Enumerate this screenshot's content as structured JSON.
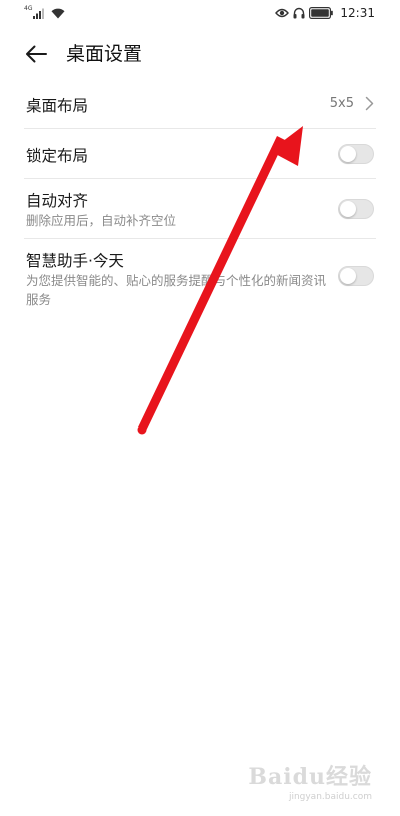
{
  "status_bar": {
    "network_label": "4G",
    "time": "12:31",
    "icons": [
      "signal-icon",
      "wifi-icon",
      "eye-icon",
      "headphones-icon",
      "battery-icon"
    ]
  },
  "header": {
    "back_icon": "arrow-left-icon",
    "title": "桌面设置"
  },
  "settings": {
    "layout": {
      "title": "桌面布局",
      "value": "5x5"
    },
    "lock": {
      "title": "锁定布局",
      "enabled": false
    },
    "align": {
      "title": "自动对齐",
      "subtitle": "删除应用后，自动补齐空位",
      "enabled": false
    },
    "assistant": {
      "title": "智慧助手·今天",
      "subtitle": "为您提供智能的、贴心的服务提醒与个性化的新闻资讯服务",
      "enabled": false
    }
  },
  "annotation": {
    "type": "arrow",
    "color": "#e8141c"
  },
  "watermark": {
    "logo": "Baidu经验",
    "url": "jingyan.baidu.com"
  },
  "colors": {
    "background": "#ffffff",
    "divider": "#e8e8e8",
    "toggle_off": "#e6e6e6",
    "secondary_text": "#8a8a8a"
  }
}
